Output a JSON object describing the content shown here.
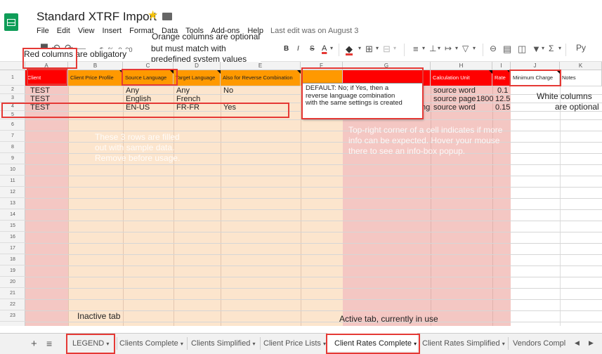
{
  "doc": {
    "title": "Standard XTRF Import",
    "last_edit": "Last edit was on August 3"
  },
  "menu": [
    "File",
    "Edit",
    "View",
    "Insert",
    "Format",
    "Data",
    "Tools",
    "Add-ons",
    "Help"
  ],
  "toolbar": {
    "percent": "%",
    "decimals": ".0  .00",
    "bold": "B",
    "italic": "I",
    "strike": "S",
    "fontcolor": "A",
    "sigma": "Σ",
    "partial": "Py"
  },
  "annotations": {
    "red_columns": "Red columns are obligatory",
    "orange_columns": [
      "Orange columns are optional",
      "but must match with",
      "predefined system values"
    ],
    "white_columns": [
      "White columns",
      "are optional"
    ],
    "sample_rows": [
      "These 3 rows are filled",
      "out with sample data.",
      "Remove before usage."
    ],
    "info_corner": [
      "Top-right corner of a cell indicates if more",
      "info can be expected. Hover your mouse",
      "there to see an info-box popup."
    ],
    "inactive_tab": "Inactive tab",
    "active_tab": "Active tab, currently in use"
  },
  "columns": [
    "A",
    "B",
    "C",
    "D",
    "E",
    "F",
    "G",
    "H",
    "I",
    "J",
    "K"
  ],
  "headers": [
    "Client",
    "Client Price Profile",
    "Source Language",
    "Target Language",
    "Also for Reverse Combination",
    "",
    "",
    "Calculation Unit",
    "Rate",
    "Minimum Charge",
    "Notes"
  ],
  "rows": [
    {
      "client": "TEST",
      "source": "Any",
      "target": "Any",
      "reverse": "No",
      "unit": "source word",
      "rate": "0.1"
    },
    {
      "client": "TEST",
      "source": "English",
      "target": "French",
      "reverse": "",
      "unit": "source page",
      "extra": "1800",
      "rate": "12.5"
    },
    {
      "client": "TEST",
      "source": "EN-US",
      "target": "FR-FR",
      "reverse": "Yes",
      "partial": "ng",
      "unit": "source word",
      "rate": "0.15"
    }
  ],
  "row_numbers": [
    "1",
    "2",
    "3",
    "4",
    "5",
    "6",
    "7",
    "8",
    "9",
    "10",
    "11",
    "12",
    "13",
    "14",
    "15",
    "16",
    "17",
    "18",
    "19",
    "20",
    "21",
    "22",
    "23"
  ],
  "popup": [
    "DEFAULT: No; if Yes, then a",
    "reverse language combination",
    "with the same settings is created"
  ],
  "tabs": [
    "LEGEND",
    "Clients Complete",
    "Clients Simplified",
    "Client Price Lists",
    "Client Rates Complete",
    "Client Rates Simplified",
    "Vendors Compl"
  ],
  "tab_controls": {
    "add": "+",
    "list": "≡",
    "arrow": "▾",
    "prev": "◀",
    "next": "▶"
  },
  "colors": {
    "red_col": "#f4c7c3",
    "orange_col": "#fce5cd",
    "red_header": "#ff0000",
    "orange_header": "#ff9900",
    "annotation_box": "#e53935"
  }
}
